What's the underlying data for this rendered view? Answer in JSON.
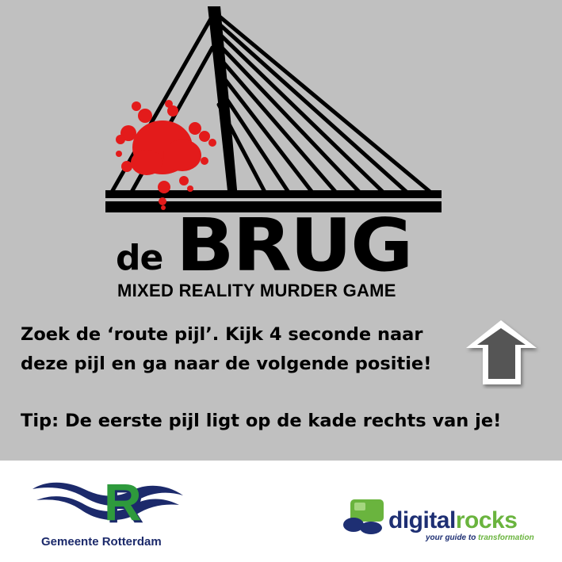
{
  "logo": {
    "prefix": "de",
    "name": "BRUG",
    "subtitle": "MIXED REALITY MURDER GAME"
  },
  "instructions": {
    "line1": "Zoek de ‘route pijl’. Kijk 4 seconde naar",
    "line2": "deze pijl en ga naar de volgende positie!",
    "tip": "Tip: De eerste pijl ligt op de kade rechts van je!"
  },
  "sponsors": {
    "rotterdam_label": "Gemeente Rotterdam",
    "digitalrocks_name_part1": "digital",
    "digitalrocks_name_part2": "rocks",
    "digitalrocks_tagline_part1": "your guide to ",
    "digitalrocks_tagline_part2": "transformation"
  },
  "colors": {
    "background": "#c0c0c0",
    "footer": "#ffffff",
    "text": "#000000",
    "blood": "#e31b1b",
    "arrow": "#555555",
    "rotterdam_blue": "#1c2a6b",
    "rotterdam_green": "#2e9a3c",
    "digitalrocks_blue": "#1e2f73",
    "digitalrocks_green": "#6ab43e"
  },
  "icons": [
    "bridge-logo-icon",
    "blood-splatter-icon",
    "up-arrow-icon",
    "rotterdam-logo-icon",
    "digitalrocks-logo-icon"
  ]
}
